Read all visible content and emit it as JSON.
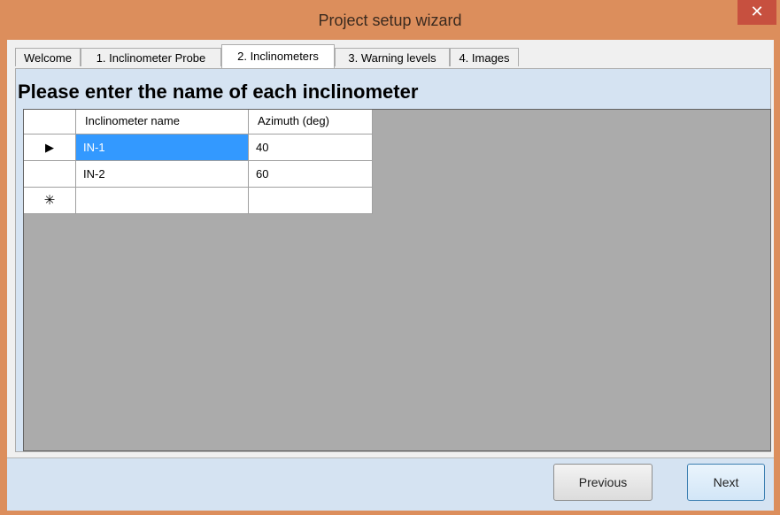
{
  "window": {
    "title": "Project setup wizard",
    "close_glyph": "✕"
  },
  "tabs": [
    {
      "label": "Welcome"
    },
    {
      "label": "1. Inclinometer Probe"
    },
    {
      "label": "2. Inclinometers"
    },
    {
      "label": "3. Warning levels"
    },
    {
      "label": "4. Images"
    }
  ],
  "active_tab": "2. Inclinometers",
  "heading": "Please enter the name of each inclinometer",
  "table": {
    "columns": [
      "Inclinometer name",
      "Azimuth (deg)"
    ],
    "rows": [
      {
        "indicator": "▶",
        "name": "IN-1",
        "azimuth": "40"
      },
      {
        "indicator": "",
        "name": "IN-2",
        "azimuth": "60"
      },
      {
        "indicator": "✳",
        "name": "",
        "azimuth": ""
      }
    ]
  },
  "buttons": {
    "previous": "Previous",
    "next": "Next"
  },
  "colors": {
    "title_bar": "#dc8e5c",
    "close_button": "#c7503f",
    "selection": "#3399ff",
    "grid_background": "#ababab",
    "panel": "#d5e3f2"
  }
}
